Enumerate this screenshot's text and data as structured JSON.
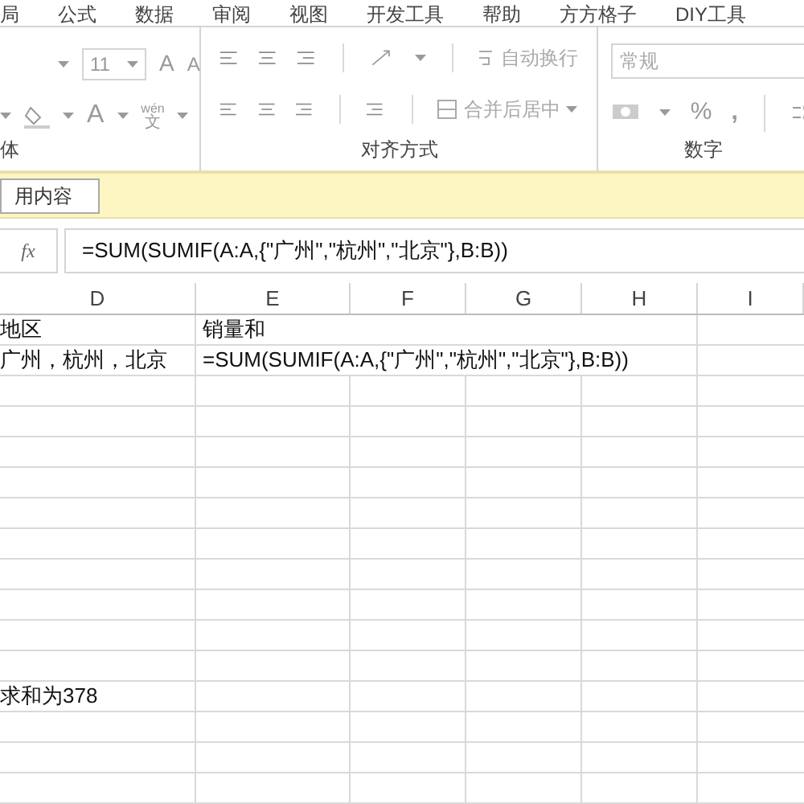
{
  "menu_tabs": [
    "局",
    "公式",
    "数据",
    "审阅",
    "视图",
    "开发工具",
    "帮助",
    "方方格子",
    "DIY工具"
  ],
  "ribbon": {
    "font_size": "11",
    "grow_font": "A",
    "shrink_font": "A",
    "font_color": "A",
    "phonetic_top": "wén",
    "phonetic_bottom": "文",
    "wrap_text": "自动换行",
    "merge_center": "合并后居中",
    "number_format": "常规",
    "percent": "%",
    "comma": ",",
    "groups": [
      "体",
      "对齐方式",
      "数字"
    ]
  },
  "message_bar": {
    "button": "用内容"
  },
  "formula_bar": {
    "function_label": "fx",
    "formula": "=SUM(SUMIF(A:A,{\"广州\",\"杭州\",\"北京\"},B:B))"
  },
  "columns": [
    "D",
    "E",
    "F",
    "G",
    "H",
    "I"
  ],
  "rows": [
    {
      "cells": [
        "地区",
        "销量和"
      ]
    },
    {
      "cells": [
        "广州，杭州，北京",
        "=SUM(SUMIF(A:A,{\"广州\",\"杭州\",\"北京\"},B:B))"
      ]
    }
  ],
  "note": "求和为378"
}
